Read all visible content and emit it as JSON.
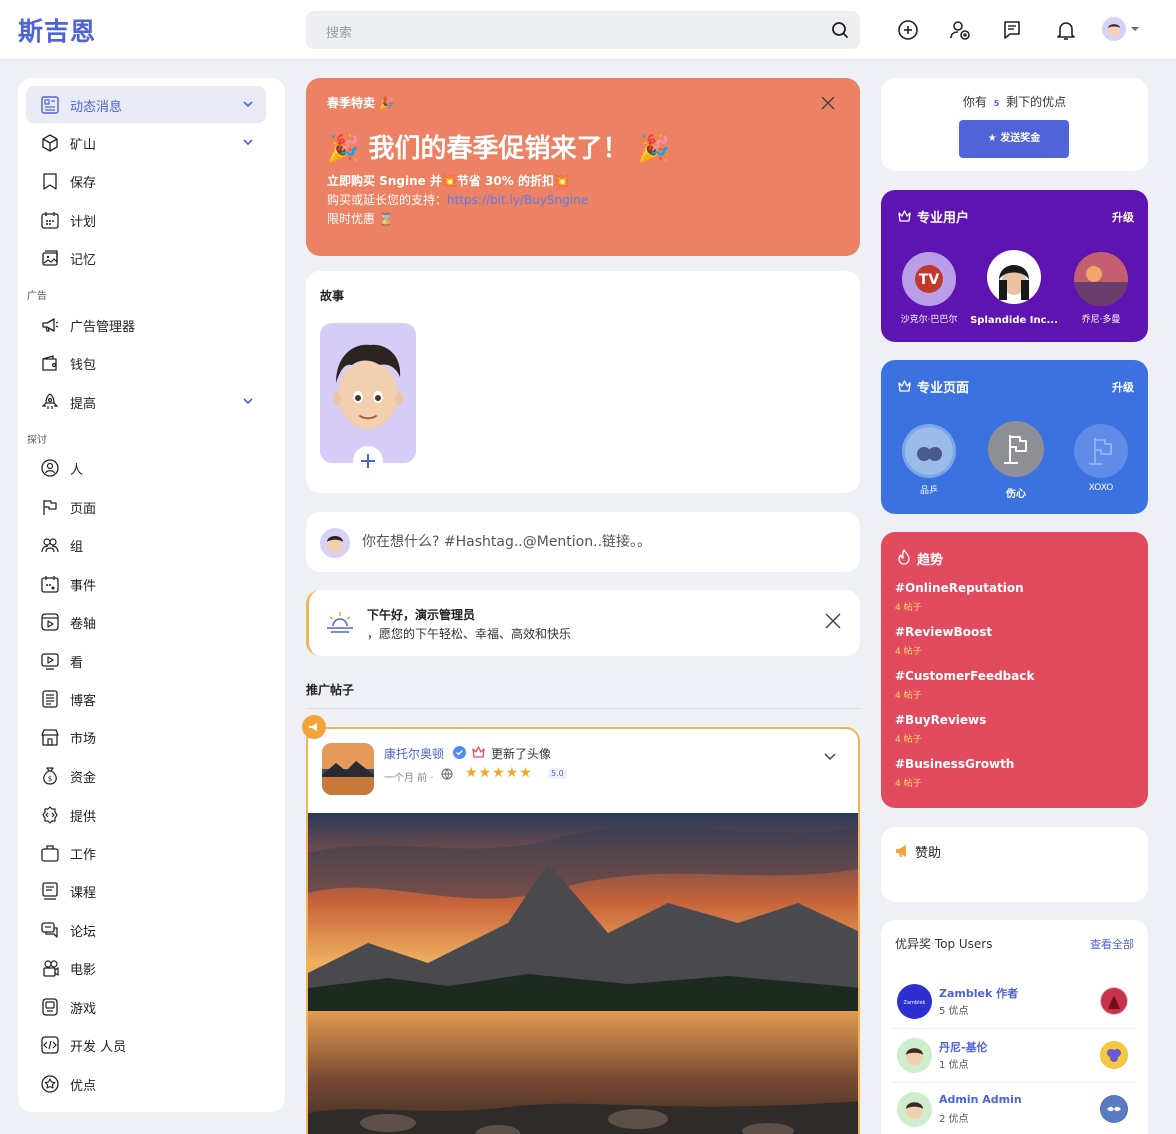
{
  "app": {
    "logo": "斯吉恩"
  },
  "search": {
    "placeholder": "搜索"
  },
  "sidebar": {
    "items": [
      {
        "label": "动态消息",
        "icon": "newsfeed-icon",
        "active": true,
        "chevron": true
      },
      {
        "label": "矿山",
        "icon": "cube-icon",
        "chevron": true
      },
      {
        "label": "保存",
        "icon": "bookmark-icon"
      },
      {
        "label": "计划",
        "icon": "calendar-icon"
      },
      {
        "label": "记忆",
        "icon": "memories-icon"
      },
      {
        "label": "广告管理器",
        "icon": "megaphone-icon"
      },
      {
        "label": "钱包",
        "icon": "wallet-icon"
      },
      {
        "label": "提高",
        "icon": "boost-icon",
        "chevron": true
      },
      {
        "label": "人",
        "icon": "people-icon"
      },
      {
        "label": "页面",
        "icon": "flag-icon"
      },
      {
        "label": "组",
        "icon": "group-icon"
      },
      {
        "label": "事件",
        "icon": "event-icon"
      },
      {
        "label": "卷轴",
        "icon": "reels-icon"
      },
      {
        "label": "看",
        "icon": "watch-icon"
      },
      {
        "label": "博客",
        "icon": "blog-icon"
      },
      {
        "label": "市场",
        "icon": "market-icon"
      },
      {
        "label": "资金",
        "icon": "money-bag-icon"
      },
      {
        "label": "提供",
        "icon": "offer-icon"
      },
      {
        "label": "工作",
        "icon": "briefcase-icon"
      },
      {
        "label": "课程",
        "icon": "course-icon"
      },
      {
        "label": "论坛",
        "icon": "forum-icon"
      },
      {
        "label": "电影",
        "icon": "movie-icon"
      },
      {
        "label": "游戏",
        "icon": "game-icon"
      },
      {
        "label": "开发 人员",
        "icon": "code-icon"
      },
      {
        "label": "优点",
        "icon": "merits-icon"
      }
    ],
    "sections": {
      "ads": "广告",
      "explore": "探讨"
    }
  },
  "promo": {
    "tag": "春季特卖",
    "headline": "我们的春季促销来了！",
    "line1": "立即购买 Sngine 并💥节省 30% 的折扣💥",
    "line2_prefix": "购买或延长您的支持：",
    "line2_link": "https://bit.ly/BuySngine",
    "line3": "限时优惠 ⌛"
  },
  "stories": {
    "title": "故事"
  },
  "composer": {
    "placeholder": "你在想什么? #Hashtag..@Mention..链接。。"
  },
  "greeting": {
    "title": "下午好，演示管理员",
    "subtitle": "，愿您的下午轻松、幸福、高效和快乐"
  },
  "promoted": {
    "title": "推广帖子"
  },
  "post": {
    "author": "康托尔奥顿",
    "action": "更新了头像",
    "time": "一个月 前 ·",
    "stars": "★★★★★",
    "rating": "5.0"
  },
  "points": {
    "prefix": "你有",
    "value": "5",
    "suffix": "剩下的优点",
    "button": "发送奖金"
  },
  "pro_users": {
    "title": "专业用户",
    "upgrade": "升级",
    "users": [
      {
        "name": "沙克尔·巴巴尔"
      },
      {
        "name": "Splandide Inc..."
      },
      {
        "name": "乔尼·多曼"
      }
    ]
  },
  "pro_pages": {
    "title": "专业页面",
    "upgrade": "升级",
    "pages": [
      {
        "name": "品乒"
      },
      {
        "name": "伤心"
      },
      {
        "name": "XOXO"
      }
    ]
  },
  "trending": {
    "title": "趋势",
    "items": [
      {
        "tag": "#OnlineReputation",
        "count": "4 帖子"
      },
      {
        "tag": "#ReviewBoost",
        "count": "4 帖子"
      },
      {
        "tag": "#CustomerFeedback",
        "count": "4 帖子"
      },
      {
        "tag": "#BuyReviews",
        "count": "4 帖子"
      },
      {
        "tag": "#BusinessGrowth",
        "count": "4 帖子"
      }
    ]
  },
  "sponsor": {
    "title": "赞助"
  },
  "top_users": {
    "title": "优异奖 Top Users",
    "see_all": "查看全部",
    "users": [
      {
        "name": "Zamblek 作者",
        "points": "5 优点",
        "avatar_text": "Zamblek"
      },
      {
        "name": "丹尼-基伦",
        "points": "1 优点"
      },
      {
        "name": "Admin Admin",
        "points": "2 优点"
      }
    ]
  },
  "colors": {
    "brand": "#4d63d8",
    "promo": "#ec8163",
    "pro_users": "#5e14b0",
    "pro_pages": "#3b72e0",
    "trending": "#e24a5e",
    "post_border": "#f2b451"
  }
}
